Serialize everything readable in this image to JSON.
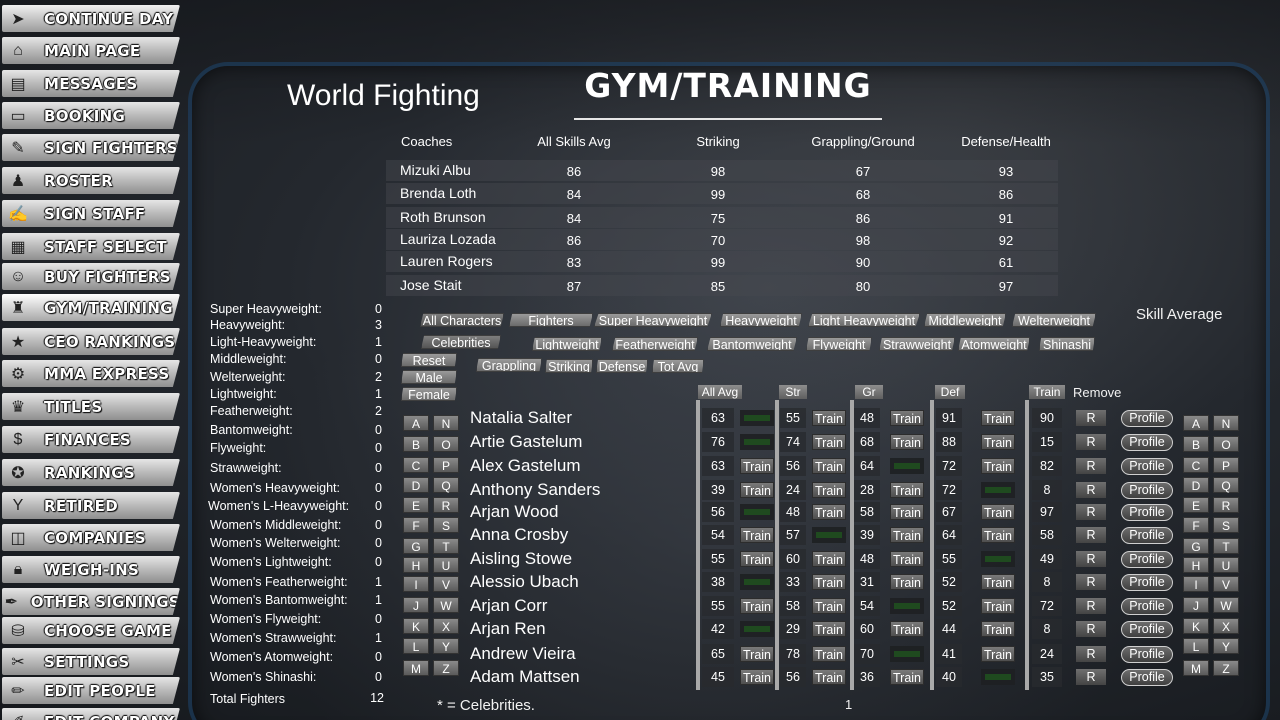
{
  "sidebar": {
    "items": [
      {
        "label": "CONTINUE DAY",
        "icon": "arrow-right-icon"
      },
      {
        "label": "MAIN PAGE",
        "icon": "home-icon"
      },
      {
        "label": "MESSAGES",
        "icon": "news-icon"
      },
      {
        "label": "BOOKING",
        "icon": "clipboard-icon"
      },
      {
        "label": "SIGN FIGHTERS",
        "icon": "contract-icon"
      },
      {
        "label": "ROSTER",
        "icon": "fighter-icon"
      },
      {
        "label": "SIGN STAFF",
        "icon": "staff-contract-icon"
      },
      {
        "label": "STAFF SELECT",
        "icon": "staff-icon"
      },
      {
        "label": "BUY FIGHTERS",
        "icon": "portrait-icon"
      },
      {
        "label": "GYM/TRAINING",
        "icon": "gym-icon"
      },
      {
        "label": "CEO RANKINGS",
        "icon": "star-icon"
      },
      {
        "label": "MMA EXPRESS",
        "icon": "gear-icon"
      },
      {
        "label": "TITLES",
        "icon": "trophy-icon"
      },
      {
        "label": "FINANCES",
        "icon": "money-icon"
      },
      {
        "label": "RANKINGS",
        "icon": "medal-icon"
      },
      {
        "label": "RETIRED",
        "icon": "cocktail-icon"
      },
      {
        "label": "COMPANIES",
        "icon": "cube-icon"
      },
      {
        "label": "WEIGH-INS",
        "icon": "lock-icon"
      },
      {
        "label": "OTHER SIGNINGS",
        "icon": "signing-icon"
      },
      {
        "label": "CHOOSE GAME",
        "icon": "game-icon"
      },
      {
        "label": "SETTINGS",
        "icon": "tools-icon"
      },
      {
        "label": "EDIT PEOPLE",
        "icon": "edit-icon"
      },
      {
        "label": "EDIT COMPANY",
        "icon": "edit-company-icon"
      }
    ]
  },
  "header": {
    "org_name": "World Fighting",
    "title": "GYM/TRAINING"
  },
  "coaches": {
    "headers": {
      "name": "Coaches",
      "all": "All Skills Avg",
      "striking": "Striking",
      "grappling": "Grappling/Ground",
      "defense": "Defense/Health"
    },
    "rows": [
      {
        "name": "Mizuki Albu",
        "all": "86",
        "striking": "98",
        "grappling": "67",
        "defense": "93"
      },
      {
        "name": "Brenda Loth",
        "all": "84",
        "striking": "99",
        "grappling": "68",
        "defense": "86"
      },
      {
        "name": "Roth Brunson",
        "all": "84",
        "striking": "75",
        "grappling": "86",
        "defense": "91"
      },
      {
        "name": "Lauriza Lozada",
        "all": "86",
        "striking": "70",
        "grappling": "98",
        "defense": "92"
      },
      {
        "name": "Lauren Rogers",
        "all": "83",
        "striking": "99",
        "grappling": "90",
        "defense": "61"
      },
      {
        "name": "Jose Stait",
        "all": "87",
        "striking": "85",
        "grappling": "80",
        "defense": "97"
      }
    ]
  },
  "weight_classes": {
    "rows": [
      {
        "label": "Super Heavyweight:",
        "value": "0"
      },
      {
        "label": "Heavyweight:",
        "value": "3"
      },
      {
        "label": "Light-Heavyweight:",
        "value": "1"
      },
      {
        "label": "Middleweight:",
        "value": "0"
      },
      {
        "label": "Welterweight:",
        "value": "2"
      },
      {
        "label": "Lightweight:",
        "value": "1"
      },
      {
        "label": "Featherweight:",
        "value": "2"
      },
      {
        "label": "Bantomweight:",
        "value": "0"
      },
      {
        "label": "Flyweight:",
        "value": "0"
      },
      {
        "label": "Strawweight:",
        "value": "0"
      },
      {
        "label": "Women's Heavyweight:",
        "value": "0"
      },
      {
        "label": "Women's L-Heavyweight:",
        "value": "0"
      },
      {
        "label": "Women's Middleweight:",
        "value": "0"
      },
      {
        "label": "Women's Welterweight:",
        "value": "0"
      },
      {
        "label": "Women's Lightweight:",
        "value": "0"
      },
      {
        "label": "Women's Featherweight:",
        "value": "1"
      },
      {
        "label": "Women's Bantomweight:",
        "value": "1"
      },
      {
        "label": "Women's Flyweight:",
        "value": "0"
      },
      {
        "label": "Women's Strawweight:",
        "value": "1"
      },
      {
        "label": "Women's Atomweight:",
        "value": "0"
      },
      {
        "label": "Women's Shinashi:",
        "value": "0"
      }
    ],
    "total_label": "Total Fighters",
    "total_value": "12"
  },
  "filters": {
    "row1": [
      "All Characters",
      "Fighters",
      "Super Heavyweight",
      "Heavyweight",
      "Light Heavyweight",
      "Middleweight",
      "Welterweight"
    ],
    "row2": [
      "Celebrities",
      "Lightweight",
      "Featherweight",
      "Bantomweight",
      "Flyweight",
      "Strawweight",
      "Atomweight",
      "Shinashi"
    ],
    "sort": [
      "Grappling",
      "Striking",
      "Defense",
      "Tot Avg"
    ],
    "side": [
      "Reset",
      "Male",
      "Female"
    ],
    "skill_average_label": "Skill Average"
  },
  "table_headers": {
    "all": "All Avg",
    "str": "Str",
    "gr": "Gr",
    "def": "Def",
    "train": "Train",
    "remove": "Remove"
  },
  "letters": [
    [
      "A",
      "N"
    ],
    [
      "B",
      "O"
    ],
    [
      "C",
      "P"
    ],
    [
      "D",
      "Q"
    ],
    [
      "E",
      "R"
    ],
    [
      "F",
      "S"
    ],
    [
      "G",
      "T"
    ],
    [
      "H",
      "U"
    ],
    [
      "I",
      "V"
    ],
    [
      "J",
      "W"
    ],
    [
      "K",
      "X"
    ],
    [
      "L",
      "Y"
    ],
    [
      "M",
      "Z"
    ]
  ],
  "labels": {
    "train": "Train",
    "remove_short": "R",
    "profile": "Profile"
  },
  "fighters": [
    {
      "name": "Natalia Salter",
      "all": "63",
      "all_train": false,
      "str": "55",
      "str_train": true,
      "gr": "48",
      "gr_train": true,
      "def": "91",
      "def_train": true,
      "train": "90"
    },
    {
      "name": "Artie Gastelum",
      "all": "76",
      "all_train": false,
      "str": "74",
      "str_train": true,
      "gr": "68",
      "gr_train": true,
      "def": "88",
      "def_train": true,
      "train": "15"
    },
    {
      "name": "Alex Gastelum",
      "all": "63",
      "all_train": true,
      "str": "56",
      "str_train": true,
      "gr": "64",
      "gr_train": false,
      "def": "72",
      "def_train": true,
      "train": "82"
    },
    {
      "name": "Anthony Sanders",
      "all": "39",
      "all_train": true,
      "str": "24",
      "str_train": true,
      "gr": "28",
      "gr_train": true,
      "def": "72",
      "def_train": false,
      "train": "8"
    },
    {
      "name": "Arjan Wood",
      "all": "56",
      "all_train": false,
      "str": "48",
      "str_train": true,
      "gr": "58",
      "gr_train": true,
      "def": "67",
      "def_train": true,
      "train": "97"
    },
    {
      "name": "Anna Crosby",
      "all": "54",
      "all_train": true,
      "str": "57",
      "str_train": false,
      "gr": "39",
      "gr_train": true,
      "def": "64",
      "def_train": true,
      "train": "58"
    },
    {
      "name": "Aisling Stowe",
      "all": "55",
      "all_train": true,
      "str": "60",
      "str_train": true,
      "gr": "48",
      "gr_train": true,
      "def": "55",
      "def_train": false,
      "train": "49"
    },
    {
      "name": "Alessio Ubach",
      "all": "38",
      "all_train": false,
      "str": "33",
      "str_train": true,
      "gr": "31",
      "gr_train": true,
      "def": "52",
      "def_train": true,
      "train": "8"
    },
    {
      "name": "Arjan Corr",
      "all": "55",
      "all_train": true,
      "str": "58",
      "str_train": true,
      "gr": "54",
      "gr_train": false,
      "def": "52",
      "def_train": true,
      "train": "72"
    },
    {
      "name": "Arjan Ren",
      "all": "42",
      "all_train": false,
      "str": "29",
      "str_train": true,
      "gr": "60",
      "gr_train": true,
      "def": "44",
      "def_train": true,
      "train": "8"
    },
    {
      "name": "Andrew Vieira",
      "all": "65",
      "all_train": true,
      "str": "78",
      "str_train": true,
      "gr": "70",
      "gr_train": false,
      "def": "41",
      "def_train": true,
      "train": "24"
    },
    {
      "name": "Adam Mattsen",
      "all": "45",
      "all_train": true,
      "str": "56",
      "str_train": true,
      "gr": "36",
      "gr_train": true,
      "def": "40",
      "def_train": false,
      "train": "35"
    }
  ],
  "footer": {
    "note": "* = Celebrities.",
    "page": "1"
  }
}
